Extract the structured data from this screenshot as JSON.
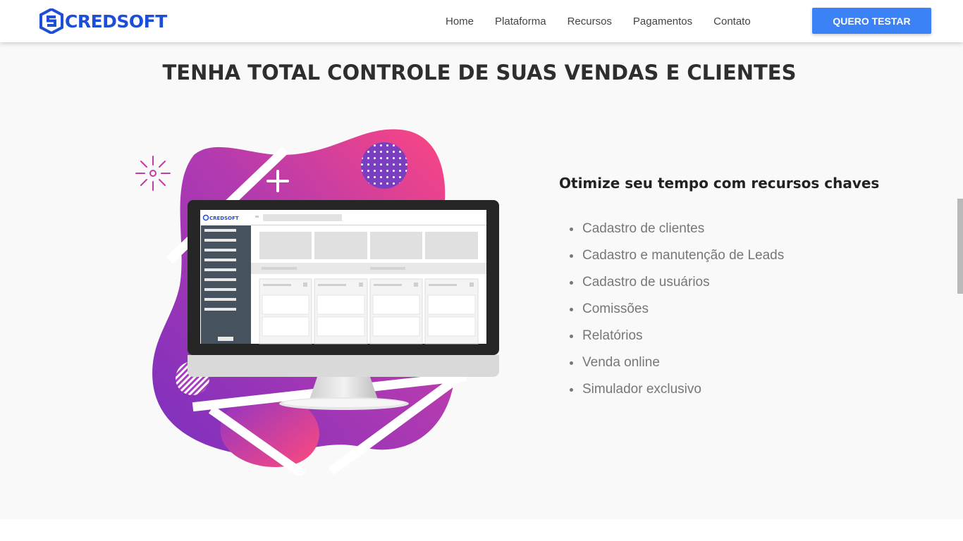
{
  "brand": {
    "name": "CREDSOFT",
    "color": "#1d4ed8"
  },
  "nav": {
    "links": [
      "Home",
      "Plataforma",
      "Recursos",
      "Pagamentos",
      "Contato"
    ],
    "cta_label": "QUERO TESTAR",
    "cta_color": "#3b82f6"
  },
  "hero": {
    "title": "TENHA TOTAL CONTROLE DE SUAS VENDAS E CLIENTES",
    "screen_logo": "CREDSOFT"
  },
  "features": {
    "title": "Otimize seu tempo com recursos chaves",
    "items": [
      "Cadastro de clientes",
      "Cadastro e manutenção de Leads",
      "Cadastro de usuários",
      "Comissões",
      "Relatórios",
      "Venda online",
      "Simulador exclusivo"
    ]
  },
  "illustration": {
    "icons": [
      "sparkle-icon",
      "plus-icon",
      "dotted-circle",
      "striped-circle",
      "monitor"
    ]
  }
}
